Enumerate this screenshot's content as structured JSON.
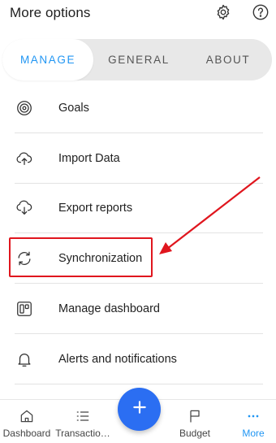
{
  "header": {
    "title": "More options",
    "icons": [
      "gear-icon",
      "help-icon"
    ]
  },
  "tabs": [
    {
      "label": "MANAGE",
      "active": true
    },
    {
      "label": "GENERAL",
      "active": false
    },
    {
      "label": "ABOUT",
      "active": false
    }
  ],
  "menu": {
    "items": [
      {
        "label": "Goals",
        "icon": "target-icon"
      },
      {
        "label": "Import Data",
        "icon": "cloud-upload-icon"
      },
      {
        "label": "Export reports",
        "icon": "cloud-download-icon"
      },
      {
        "label": "Synchronization",
        "icon": "sync-icon"
      },
      {
        "label": "Manage dashboard",
        "icon": "dashboard-layout-icon"
      },
      {
        "label": "Alerts and notifications",
        "icon": "bell-icon"
      }
    ]
  },
  "bottom_nav": {
    "items": [
      {
        "label": "Dashboard",
        "icon": "home-icon",
        "active": false
      },
      {
        "label": "Transactio…",
        "icon": "list-icon",
        "active": false
      },
      {
        "label": "Budget",
        "icon": "flag-icon",
        "active": false
      },
      {
        "label": "More",
        "icon": "more-dots-icon",
        "active": true
      }
    ],
    "fab_icon": "plus-icon"
  },
  "colors": {
    "accent": "#2196f3",
    "fab": "#2b6ef2",
    "annotation": "#e0161e"
  }
}
